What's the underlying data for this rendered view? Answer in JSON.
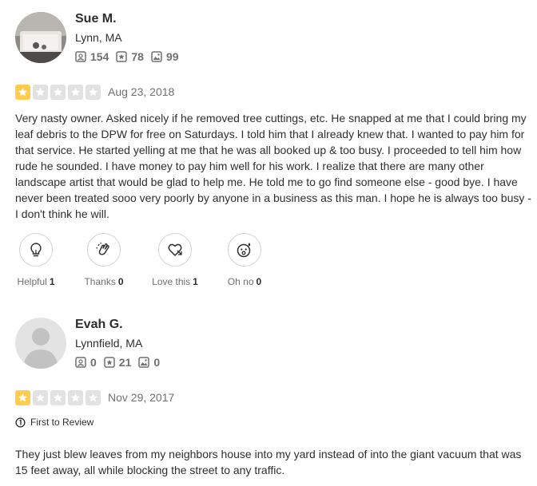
{
  "reviews": [
    {
      "user": {
        "name": "Sue M.",
        "location": "Lynn, MA",
        "friends": "154",
        "reviews": "78",
        "photos": "99"
      },
      "rating": 1,
      "date": "Aug 23, 2018",
      "text": "Very nasty owner. Asked nicely if he removed tree cuttings, etc. He snapped at me that I could bring my leaf debris to the DPW for free on Saturdays. I told him that I already knew that. I wanted to pay him for that service. He started yelling at me that he was all booked up & too busy. I proceeded to tell him how rude he sounded. I have money to pay him well for his work. I realize that there are many other landscape artist that would be glad to help me. He told me to go find someone else - good bye. I have never been treated sooo very poorly by anyone in a business as this man. I hope he is always too busy - I don't think he will.",
      "reactions": {
        "helpful": {
          "label": "Helpful",
          "count": "1"
        },
        "thanks": {
          "label": "Thanks",
          "count": "0"
        },
        "love": {
          "label": "Love this",
          "count": "1"
        },
        "ohno": {
          "label": "Oh no",
          "count": "0"
        }
      }
    },
    {
      "user": {
        "name": "Evah G.",
        "location": "Lynnfield, MA",
        "friends": "0",
        "reviews": "21",
        "photos": "0"
      },
      "rating": 1,
      "date": "Nov 29, 2017",
      "badge": "First to Review",
      "text": "They just blew leaves from my neighbors house into my yard instead of into the giant vacuum that was 15 feet away, all while blocking the street to any traffic."
    }
  ],
  "colors": {
    "star_on": "#ffcc4b",
    "star_off": "#e2e2e2",
    "muted": "#6e7072",
    "text": "#2d2e2f"
  }
}
